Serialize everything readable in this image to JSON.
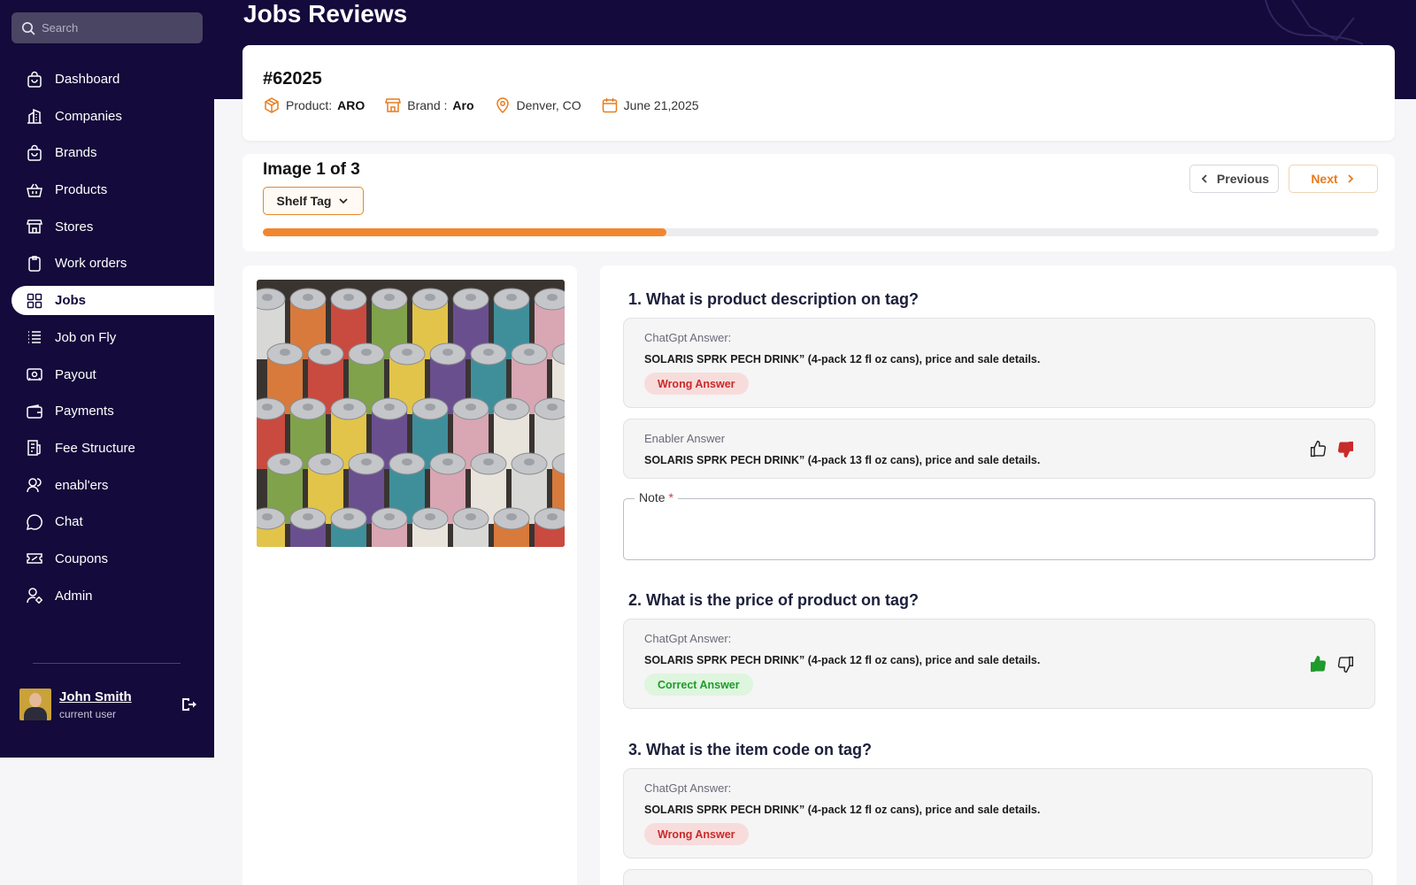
{
  "app": {
    "page_title": "Jobs Reviews"
  },
  "search": {
    "placeholder": "Search"
  },
  "sidebar": {
    "items": [
      {
        "label": "Dashboard",
        "icon": "bag-icon"
      },
      {
        "label": "Companies",
        "icon": "building-icon"
      },
      {
        "label": "Brands",
        "icon": "bag-icon"
      },
      {
        "label": "Products",
        "icon": "basket-icon"
      },
      {
        "label": "Stores",
        "icon": "store-icon"
      },
      {
        "label": "Work orders",
        "icon": "clipboard-icon"
      },
      {
        "label": "Jobs",
        "icon": "grid-icon",
        "active": true
      },
      {
        "label": "Job on Fly",
        "icon": "list-icon"
      },
      {
        "label": "Payout",
        "icon": "payout-icon"
      },
      {
        "label": "Payments",
        "icon": "wallet-icon"
      },
      {
        "label": "Fee Structure",
        "icon": "receipt-icon"
      },
      {
        "label": "enabl'ers",
        "icon": "users-icon"
      },
      {
        "label": "Chat",
        "icon": "chat-icon"
      },
      {
        "label": "Coupons",
        "icon": "coupon-icon"
      },
      {
        "label": "Admin",
        "icon": "admin-icon"
      }
    ]
  },
  "user": {
    "name": "John Smith",
    "role": "current user"
  },
  "job": {
    "id": "#62025",
    "product_label": "Product:",
    "product_value": "ARO",
    "brand_label": "Brand :",
    "brand_value": "Aro",
    "location": "Denver, CO",
    "date": "June 21,2025"
  },
  "image_nav": {
    "count_label": "Image 1 of 3",
    "tag_select": "Shelf Tag",
    "prev_label": "Previous",
    "next_label": "Next",
    "progress_fraction": 0.362
  },
  "questions": [
    {
      "title": "1.  What is product description on tag?",
      "chatgpt_label": "ChatGpt Answer:",
      "chatgpt_text": "SOLARIS SPRK PECH DRINK” (4-pack 12 fl oz cans), price and sale details.",
      "badge": "Wrong Answer",
      "enabler_label": "Enabler Answer",
      "enabler_text": "SOLARIS SPRK PECH DRINK” (4-pack 13 fl oz cans), price and sale details.",
      "note_label": "Note",
      "note_required": "*"
    },
    {
      "title": "2.  What is the price of product on tag?",
      "chatgpt_label": "ChatGpt Answer:",
      "chatgpt_text": "SOLARIS SPRK PECH DRINK” (4-pack 12 fl oz cans), price and sale details.",
      "badge": "Correct Answer"
    },
    {
      "title": "3.  What is the item code on tag?",
      "chatgpt_label": "ChatGpt Answer:",
      "chatgpt_text": "SOLARIS SPRK PECH DRINK” (4-pack 12 fl oz cans), price and sale details.",
      "badge": "Wrong Answer"
    }
  ],
  "colors": {
    "sidebar_bg": "#140a3b",
    "accent_orange": "#f2862e",
    "wrong_red": "#c92a2a",
    "correct_green": "#1f9a2b"
  }
}
